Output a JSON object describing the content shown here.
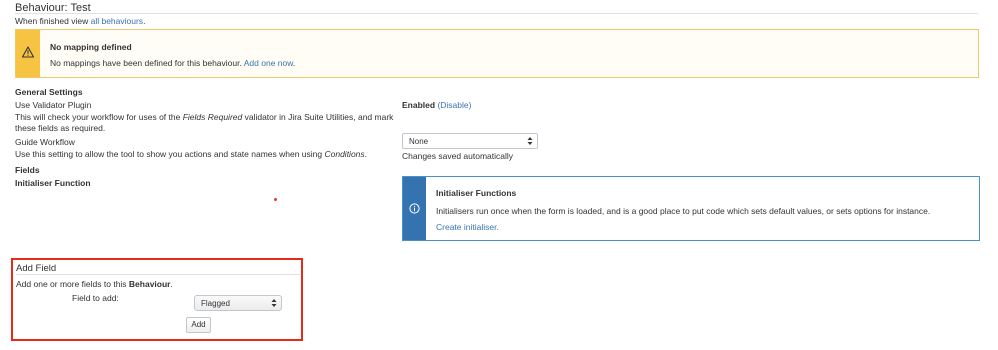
{
  "header": {
    "title": "Behaviour: Test",
    "finished_prefix": "When finished view",
    "finished_link": "all behaviours",
    "finished_suffix": "."
  },
  "warning": {
    "icon": "warning-triangle-icon",
    "title": "No mapping defined",
    "text": "No mappings have been defined for this behaviour.",
    "link": "Add one now",
    "link_suffix": ".",
    "colors": {
      "stripe": "#f6c342",
      "border": "#f0c869"
    }
  },
  "general_settings": {
    "heading": "General Settings",
    "validator": {
      "label": "Use Validator Plugin",
      "desc_1": "This will check your workflow for uses of the ",
      "desc_em": "Fields Required",
      "desc_2": " validator in Jira Suite Utilities, and mark these fields as required.",
      "status": "Enabled",
      "toggle_link": "(Disable)"
    },
    "guide_workflow": {
      "label": "Guide Workflow",
      "desc_1": "Use this setting to allow the tool to show you actions and state names when using ",
      "desc_em": "Conditions",
      "desc_2": ".",
      "selected": "None",
      "saved_note": "Changes saved automatically"
    }
  },
  "fields": {
    "heading": "Fields",
    "initialiser_heading": "Initialiser Function"
  },
  "info": {
    "icon": "info-circle-icon",
    "title": "Initialiser Functions",
    "text": "Initialisers run once when the form is loaded, and is a good place to put code which sets default values, or sets options for instance.",
    "link": "Create initialiser.",
    "colors": {
      "stripe": "#3572b0",
      "border": "#4a90c9"
    }
  },
  "add_field": {
    "title": "Add Field",
    "desc_1": "Add one or more fields to this ",
    "desc_bold": "Behaviour",
    "desc_2": ".",
    "field_label": "Field to add:",
    "selected": "Flagged",
    "button": "Add",
    "highlight_color": "#e62b16"
  }
}
